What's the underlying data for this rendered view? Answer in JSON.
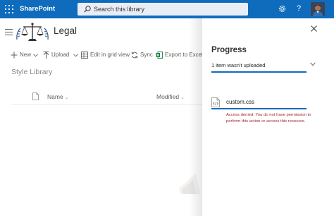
{
  "suitebar": {
    "app_name": "SharePoint",
    "search_placeholder": "Search this library",
    "color": "#0f6cbd"
  },
  "site": {
    "title": "Legal"
  },
  "commandbar": {
    "new_label": "New",
    "upload_label": "Upload",
    "grid_label": "Edit in grid view",
    "sync_label": "Sync",
    "export_label": "Export to Excel"
  },
  "library": {
    "name": "Style Library",
    "columns": [
      "Name",
      "Modified"
    ]
  },
  "progress_panel": {
    "title": "Progress",
    "summary": "1 item wasn't uploaded",
    "file": {
      "name": "custom.css",
      "error": "Access denied. You do not have permission to perform this action or access this resource."
    },
    "error_color": "#a4262c"
  },
  "icons": [
    "waffle-icon",
    "search-icon",
    "gear-icon",
    "help-icon",
    "close-icon",
    "chevron-down-icon",
    "code-file-icon",
    "plus-icon",
    "upload-icon",
    "grid-icon",
    "sync-icon",
    "excel-icon",
    "document-icon",
    "hamburger-icon"
  ]
}
